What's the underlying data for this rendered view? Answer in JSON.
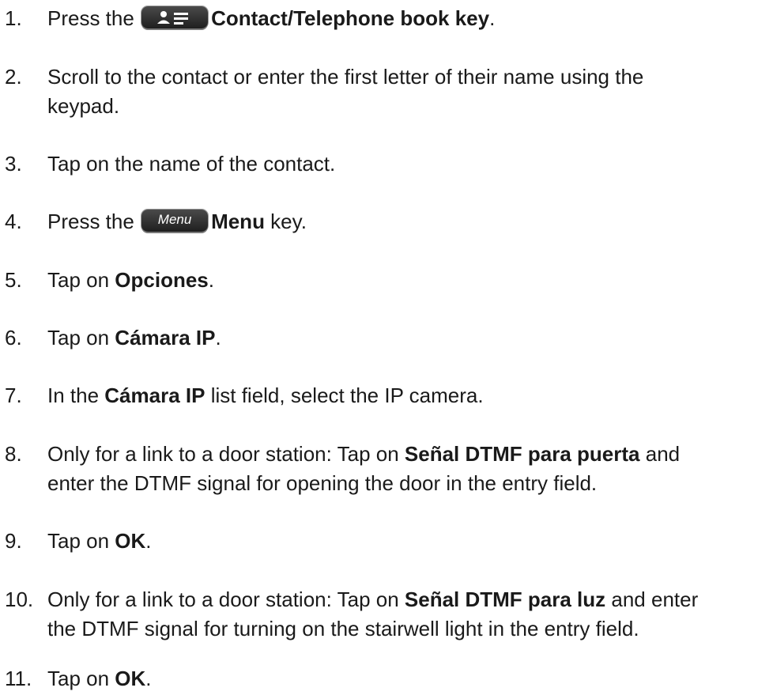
{
  "steps": [
    {
      "number": "1.",
      "parts": [
        "Press the",
        "Contact/Telephone book key",
        "."
      ]
    },
    {
      "number": "2.",
      "lines": [
        "Scroll to the contact or enter the first letter of their name using the",
        "keypad."
      ]
    },
    {
      "number": "3.",
      "text": "Tap on the name of the contact."
    },
    {
      "number": "4.",
      "parts": [
        "Press the",
        "Menu",
        " key."
      ],
      "key_label": "Menu"
    },
    {
      "number": "5.",
      "parts": [
        "Tap on ",
        "Opciones",
        "."
      ]
    },
    {
      "number": "6.",
      "parts": [
        "Tap on ",
        "Cámara IP",
        "."
      ]
    },
    {
      "number": "7.",
      "parts": [
        "In the ",
        "Cámara IP",
        " list field, select the IP camera."
      ]
    },
    {
      "number": "8.",
      "parts": [
        "Only for a link to a door station: Tap on ",
        "Señal DTMF para puerta",
        " and"
      ],
      "line2": "enter the DTMF signal for opening the door in the entry field."
    },
    {
      "number": "9.",
      "parts": [
        "Tap on ",
        "OK",
        "."
      ]
    },
    {
      "number": "10.",
      "parts": [
        "Only for a link to a door station: Tap on ",
        "Señal DTMF para luz",
        " and enter"
      ],
      "line2": "the DTMF signal for turning on the stairwell light in the entry field."
    },
    {
      "number": "11.",
      "parts": [
        "Tap on ",
        "OK",
        "."
      ]
    }
  ],
  "icons": {
    "contact_key": "contact-book-key-icon",
    "menu_key": "menu-key-icon"
  }
}
